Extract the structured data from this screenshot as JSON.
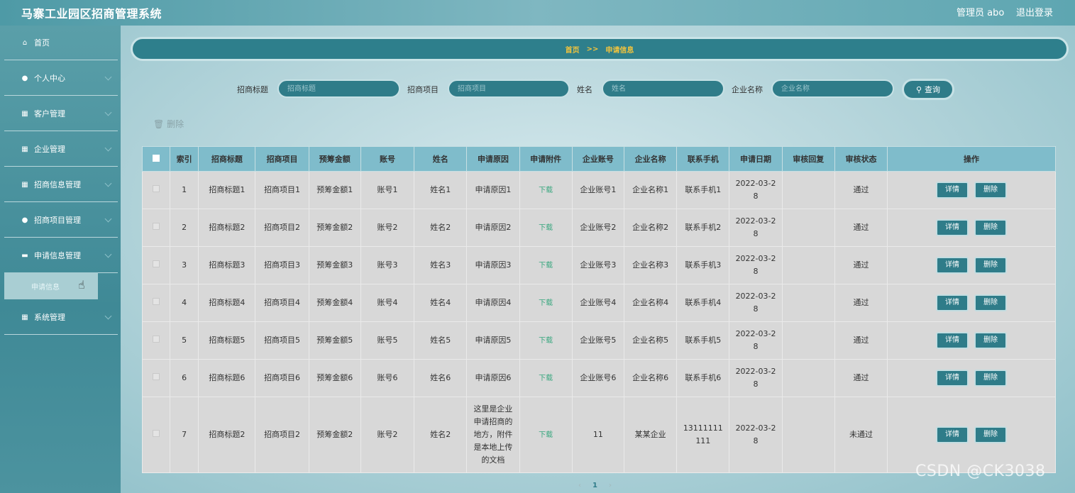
{
  "app": {
    "title": "马寨工业园区招商管理系统",
    "user": "管理员 abo",
    "logout": "退出登录"
  },
  "sidebar": {
    "items": [
      {
        "label": "首页",
        "icon": "home-icon"
      },
      {
        "label": "个人中心",
        "icon": "person-icon"
      },
      {
        "label": "客户管理",
        "icon": "grid-icon"
      },
      {
        "label": "企业管理",
        "icon": "grid-icon"
      },
      {
        "label": "招商信息管理",
        "icon": "grid-icon"
      },
      {
        "label": "招商项目管理",
        "icon": "person-icon"
      },
      {
        "label": "申请信息管理",
        "icon": "briefcase-icon"
      },
      {
        "label": "系统管理",
        "icon": "grid-icon"
      }
    ],
    "sub_active": "申请信息"
  },
  "breadcrumb": {
    "home": "首页",
    "sep": ">>",
    "current": "申请信息"
  },
  "search": {
    "fields": [
      {
        "label": "招商标题",
        "placeholder": "招商标题"
      },
      {
        "label": "招商项目",
        "placeholder": "招商项目"
      },
      {
        "label": "姓名",
        "placeholder": "姓名"
      },
      {
        "label": "企业名称",
        "placeholder": "企业名称"
      }
    ],
    "button": "查询"
  },
  "toolbar": {
    "delete_label": "删除"
  },
  "table": {
    "columns": [
      "索引",
      "招商标题",
      "招商项目",
      "预筹金额",
      "账号",
      "姓名",
      "申请原因",
      "申请附件",
      "企业账号",
      "企业名称",
      "联系手机",
      "申请日期",
      "审核回复",
      "审核状态",
      "操作"
    ],
    "rows": [
      {
        "idx": "1",
        "title": "招商标题1",
        "project": "招商项目1",
        "amount": "预筹金额1",
        "account": "账号1",
        "name": "姓名1",
        "reason": "申请原因1",
        "attach": "下载",
        "corp_account": "企业账号1",
        "corp_name": "企业名称1",
        "phone": "联系手机1",
        "date": "2022-03-28",
        "reply": "",
        "status": "通过"
      },
      {
        "idx": "2",
        "title": "招商标题2",
        "project": "招商项目2",
        "amount": "预筹金额2",
        "account": "账号2",
        "name": "姓名2",
        "reason": "申请原因2",
        "attach": "下载",
        "corp_account": "企业账号2",
        "corp_name": "企业名称2",
        "phone": "联系手机2",
        "date": "2022-03-28",
        "reply": "",
        "status": "通过"
      },
      {
        "idx": "3",
        "title": "招商标题3",
        "project": "招商项目3",
        "amount": "预筹金额3",
        "account": "账号3",
        "name": "姓名3",
        "reason": "申请原因3",
        "attach": "下载",
        "corp_account": "企业账号3",
        "corp_name": "企业名称3",
        "phone": "联系手机3",
        "date": "2022-03-28",
        "reply": "",
        "status": "通过"
      },
      {
        "idx": "4",
        "title": "招商标题4",
        "project": "招商项目4",
        "amount": "预筹金额4",
        "account": "账号4",
        "name": "姓名4",
        "reason": "申请原因4",
        "attach": "下载",
        "corp_account": "企业账号4",
        "corp_name": "企业名称4",
        "phone": "联系手机4",
        "date": "2022-03-28",
        "reply": "",
        "status": "通过"
      },
      {
        "idx": "5",
        "title": "招商标题5",
        "project": "招商项目5",
        "amount": "预筹金额5",
        "account": "账号5",
        "name": "姓名5",
        "reason": "申请原因5",
        "attach": "下载",
        "corp_account": "企业账号5",
        "corp_name": "企业名称5",
        "phone": "联系手机5",
        "date": "2022-03-28",
        "reply": "",
        "status": "通过"
      },
      {
        "idx": "6",
        "title": "招商标题6",
        "project": "招商项目6",
        "amount": "预筹金额6",
        "account": "账号6",
        "name": "姓名6",
        "reason": "申请原因6",
        "attach": "下载",
        "corp_account": "企业账号6",
        "corp_name": "企业名称6",
        "phone": "联系手机6",
        "date": "2022-03-28",
        "reply": "",
        "status": "通过"
      },
      {
        "idx": "7",
        "title": "招商标题2",
        "project": "招商项目2",
        "amount": "预筹金额2",
        "account": "账号2",
        "name": "姓名2",
        "reason": "这里是企业申请招商的地方，附件是本地上传的文档",
        "attach": "下载",
        "corp_account": "11",
        "corp_name": "某某企业",
        "phone": "13111111111",
        "date": "2022-03-28",
        "reply": "",
        "status": "未通过"
      }
    ],
    "actions": {
      "detail": "详情",
      "delete": "删除"
    }
  },
  "pager": {
    "prev": "‹",
    "current": "1",
    "next": "›"
  },
  "watermark": "CSDN @CK3038"
}
